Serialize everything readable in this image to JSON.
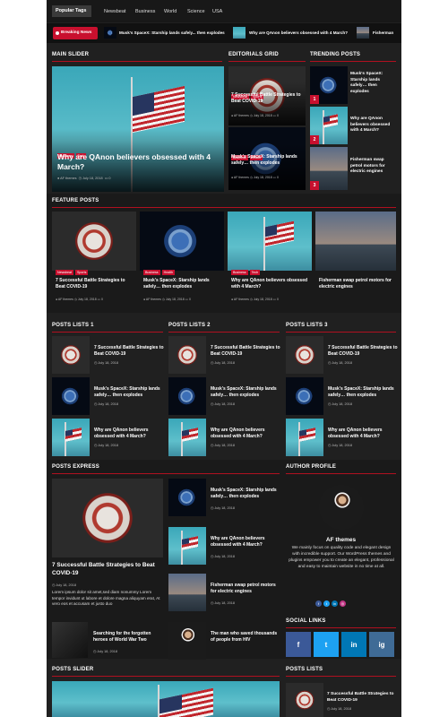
{
  "nav": {
    "popular_tags": "Popular Tags",
    "tags": [
      "Newsbeat",
      "Business",
      "World",
      "Science",
      "USA"
    ]
  },
  "breaking": {
    "label": "Breaking News",
    "items": [
      "Musk's SpaceX: Starship lands safely... then explodes",
      "Why are QAnon believers obsessed with 4 March?",
      "Fisherman"
    ]
  },
  "sections": {
    "main_slider": "Main Slider",
    "editorials": "Editorials Grid",
    "trending": "Trending Posts",
    "feature": "Feature Posts",
    "list1": "Posts Lists 1",
    "list2": "Posts Lists 2",
    "list3": "Posts Lists 3",
    "express": "Posts Express",
    "author": "Author Profile",
    "social": "Social Links",
    "posts_slider": "Posts Slider",
    "posts_lists": "Posts Lists"
  },
  "main_slider": {
    "tags": [
      "Business",
      "Tech"
    ],
    "title": "Why are QAnon believers obsessed with 4 March?",
    "author": "AF themes",
    "date": "July 18, 2018",
    "comments": "0"
  },
  "editorials": [
    {
      "tags": [
        "Newsbeat",
        "Sports"
      ],
      "title": "7 Successful Battle Strategies to Beat COVID-19",
      "author": "AF themes",
      "date": "July 18, 2018",
      "comments": "0"
    },
    {
      "tags": [
        "Business",
        "Health"
      ],
      "title": "Musk's SpaceX: Starship lands safely… then explodes",
      "author": "AF themes",
      "date": "July 18, 2018",
      "comments": "0"
    }
  ],
  "trending": [
    {
      "rank": "1",
      "title": "Musk's SpaceX: Starship lands safely… then explodes"
    },
    {
      "rank": "2",
      "title": "Why are QAnon believers obsessed with 4 March?"
    },
    {
      "rank": "3",
      "title": "Fisherman swap petrol motors for electric engines"
    }
  ],
  "feature": [
    {
      "tags": [
        "Newsbeat",
        "Sports"
      ],
      "title": "7 Successful Battle Strategies to Beat COVID-19",
      "author": "AF themes",
      "date": "July 18, 2018",
      "comments": "0"
    },
    {
      "tags": [
        "Business",
        "Health"
      ],
      "title": "Musk's SpaceX: Starship lands safely… then explodes",
      "author": "AF themes",
      "date": "July 18, 2018",
      "comments": "0"
    },
    {
      "tags": [
        "Business",
        "Tech"
      ],
      "title": "Why are QAnon believers obsessed with 4 March?",
      "author": "AF themes",
      "date": "July 18, 2018",
      "comments": "0"
    },
    {
      "tags": [],
      "title": "Fisherman swap petrol motors for electric engines",
      "author": "",
      "date": "",
      "comments": ""
    }
  ],
  "lists": [
    [
      {
        "title": "7 Successful Battle Strategies to Beat COVID-19",
        "date": "July 18, 2018"
      },
      {
        "title": "Musk's SpaceX: Starship lands safely… then explodes",
        "date": "July 18, 2018"
      },
      {
        "title": "Why are QAnon believers obsessed with 4 March?",
        "date": "July 18, 2018"
      }
    ],
    [
      {
        "title": "7 Successful Battle Strategies to Beat COVID-19",
        "date": "July 18, 2018"
      },
      {
        "title": "Musk's SpaceX: Starship lands safely… then explodes",
        "date": "July 18, 2018"
      },
      {
        "title": "Why are QAnon believers obsessed with 4 March?",
        "date": "July 18, 2018"
      }
    ],
    [
      {
        "title": "7 Successful Battle Strategies to Beat COVID-19",
        "date": "July 18, 2018"
      },
      {
        "title": "Musk's SpaceX: Starship lands safely… then explodes",
        "date": "July 18, 2018"
      },
      {
        "title": "Why are QAnon believers obsessed with 4 March?",
        "date": "July 18, 2018"
      }
    ]
  ],
  "express": {
    "main": {
      "title": "7 Successful Battle Strategies to Beat COVID-19",
      "date": "July 18, 2018",
      "excerpt": "Lorem ipsum dolor sit amet,sed diam nonummy Lorem tempor invidunt ut labore et dolore magna aliquyam erat, At vero eos et accusam et justo duo"
    },
    "bottom": {
      "title": "Searching for the forgotten heroes of World War Two",
      "date": "July 18, 2018"
    },
    "side": [
      {
        "title": "Musk's SpaceX: Starship lands safely… then explodes",
        "date": "July 18, 2018"
      },
      {
        "title": "Why are QAnon believers obsessed with 4 March?",
        "date": "July 18, 2018"
      },
      {
        "title": "Fisherman swap petrol motors for electric engines",
        "date": "July 18, 2018"
      },
      {
        "title": "The man who saved thousands of people from HIV",
        "date": "July 18, 2018"
      }
    ]
  },
  "author": {
    "name": "AF themes",
    "bio": "We mainly focus on quality code and elegant design with incredible support. Our WordPress themes and plugins empower you to create an elegant, professional and easy to maintain website in no time at all."
  },
  "social": {
    "links": [
      "f",
      "t",
      "in",
      "ig"
    ],
    "colors": {
      "facebook": "#3b5998",
      "twitter": "#1da1f2",
      "linkedin": "#0077b5",
      "instagram": "#3f6b96"
    }
  },
  "posts_lists": [
    {
      "title": "7 Successful Battle Strategies to Beat COVID-19",
      "date": "July 18, 2018"
    }
  ],
  "colors": {
    "accent": "#c8102e",
    "background": "#202020",
    "header": "#141414"
  }
}
